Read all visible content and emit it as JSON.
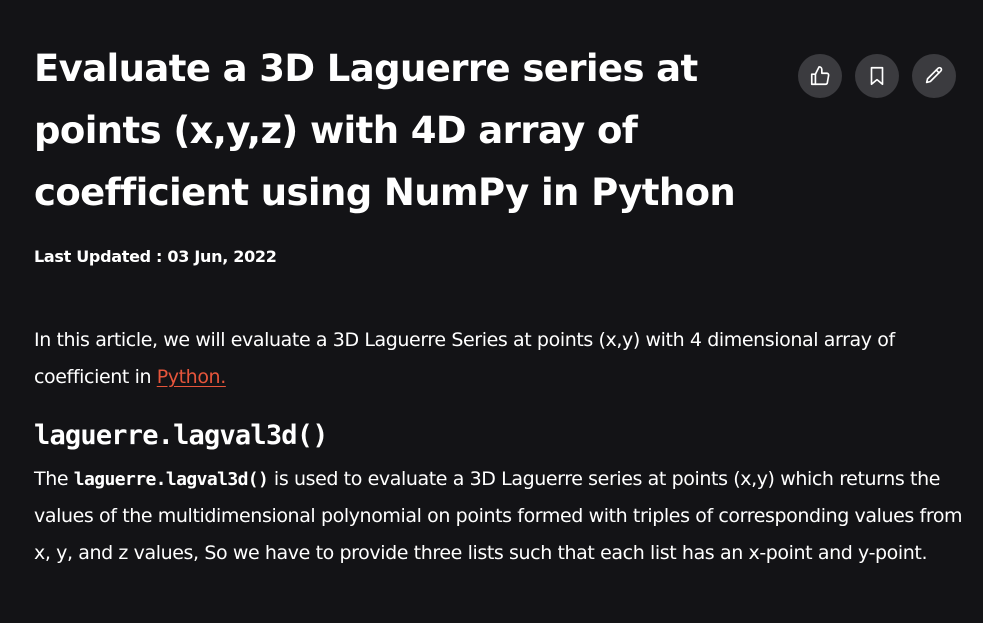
{
  "article": {
    "title": "Evaluate a 3D Laguerre series at points (x,y,z) with 4D array of coefficient using NumPy in Python",
    "last_updated": "Last Updated : 03 Jun, 2022",
    "intro_text": "In this article, we will evaluate a 3D Laguerre Series at points (x,y) with 4 dimensional array of coefficient in ",
    "intro_link": "Python.",
    "section_heading": "laguerre.lagval3d()",
    "desc_prefix": "The ",
    "desc_code": "laguerre.lagval3d()",
    "desc_rest": " is used to evaluate a 3D Laguerre series at points (x,y)  which returns the values of the multidimensional polynomial on points formed with triples of corresponding values from x, y, and z values, So we have to provide three lists such that each list has an x-point and y-point."
  },
  "actions": {
    "like_icon": "thumbs-up-icon",
    "bookmark_icon": "bookmark-icon",
    "edit_icon": "pencil-icon"
  },
  "colors": {
    "background": "#131316",
    "text": "#ffffff",
    "link": "#e6553b",
    "action_button": "#3b3b3f"
  }
}
